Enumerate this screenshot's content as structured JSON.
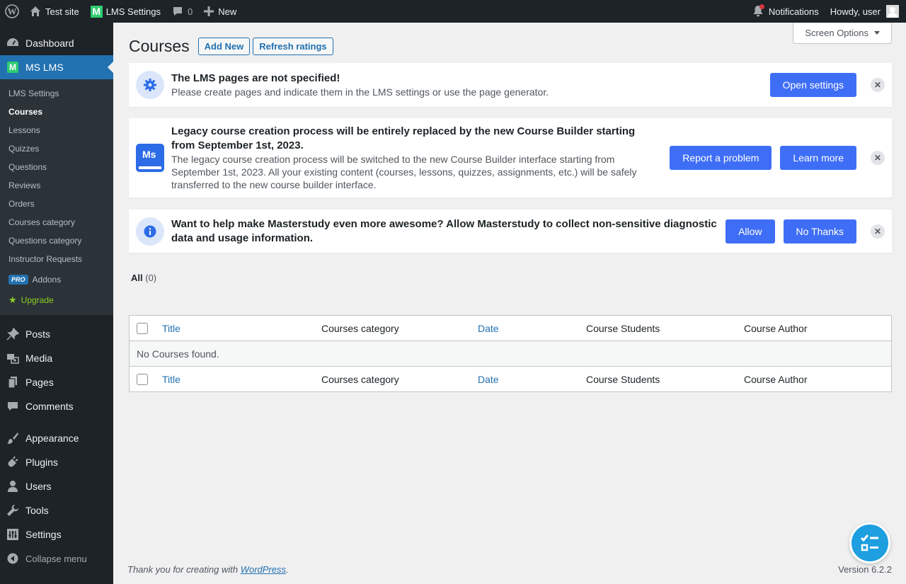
{
  "adminbar": {
    "site_name": "Test site",
    "lms_settings": "LMS Settings",
    "lms_logo_letter": "M",
    "comments_count": "0",
    "new_label": "New",
    "notifications": "Notifications",
    "howdy": "Howdy, user"
  },
  "sidebar": {
    "dashboard": "Dashboard",
    "ms_lms": "MS LMS",
    "ms_logo_letter": "M",
    "submenu": [
      "LMS Settings",
      "Courses",
      "Lessons",
      "Quizzes",
      "Questions",
      "Reviews",
      "Orders",
      "Courses category",
      "Questions category",
      "Instructor Requests"
    ],
    "pro_badge": "PRO",
    "addons": "Addons",
    "upgrade": "Upgrade",
    "posts": "Posts",
    "media": "Media",
    "pages": "Pages",
    "comments": "Comments",
    "appearance": "Appearance",
    "plugins": "Plugins",
    "users": "Users",
    "tools": "Tools",
    "settings": "Settings",
    "collapse": "Collapse menu"
  },
  "header": {
    "screen_options": "Screen Options",
    "title": "Courses",
    "add_new": "Add New",
    "refresh_ratings": "Refresh ratings"
  },
  "notices": {
    "pages": {
      "title": "The LMS pages are not specified!",
      "desc": "Please create pages and indicate them in the LMS settings or use the page generator.",
      "button": "Open settings"
    },
    "legacy": {
      "logo_text": "Ms",
      "title": "Legacy course creation process will be entirely replaced by the new Course Builder starting from September 1st, 2023.",
      "desc": "The legacy course creation process will be switched to the new Course Builder interface starting from September 1st, 2023. All your existing content (courses, lessons, quizzes, assignments, etc.) will be safely transferred to the new course builder interface.",
      "button1": "Report a problem",
      "button2": "Learn more"
    },
    "diagnostic": {
      "title": "Want to help make Masterstudy even more awesome? Allow Masterstudy to collect non-sensitive diagnostic data and usage information.",
      "button1": "Allow",
      "button2": "No Thanks"
    }
  },
  "filter": {
    "all_label": "All",
    "all_count": "(0)"
  },
  "table": {
    "columns": [
      "Title",
      "Courses category",
      "Date",
      "Course Students",
      "Course Author"
    ],
    "empty": "No Courses found."
  },
  "footer": {
    "thanks_prefix": "Thank you for creating with",
    "wp_link": "WordPress",
    "thanks_suffix": ".",
    "version": "Version 6.2.2"
  },
  "colors": {
    "accent": "#2271b1",
    "notice_button": "#3f6ef6",
    "admin_dark": "#1d2327"
  }
}
